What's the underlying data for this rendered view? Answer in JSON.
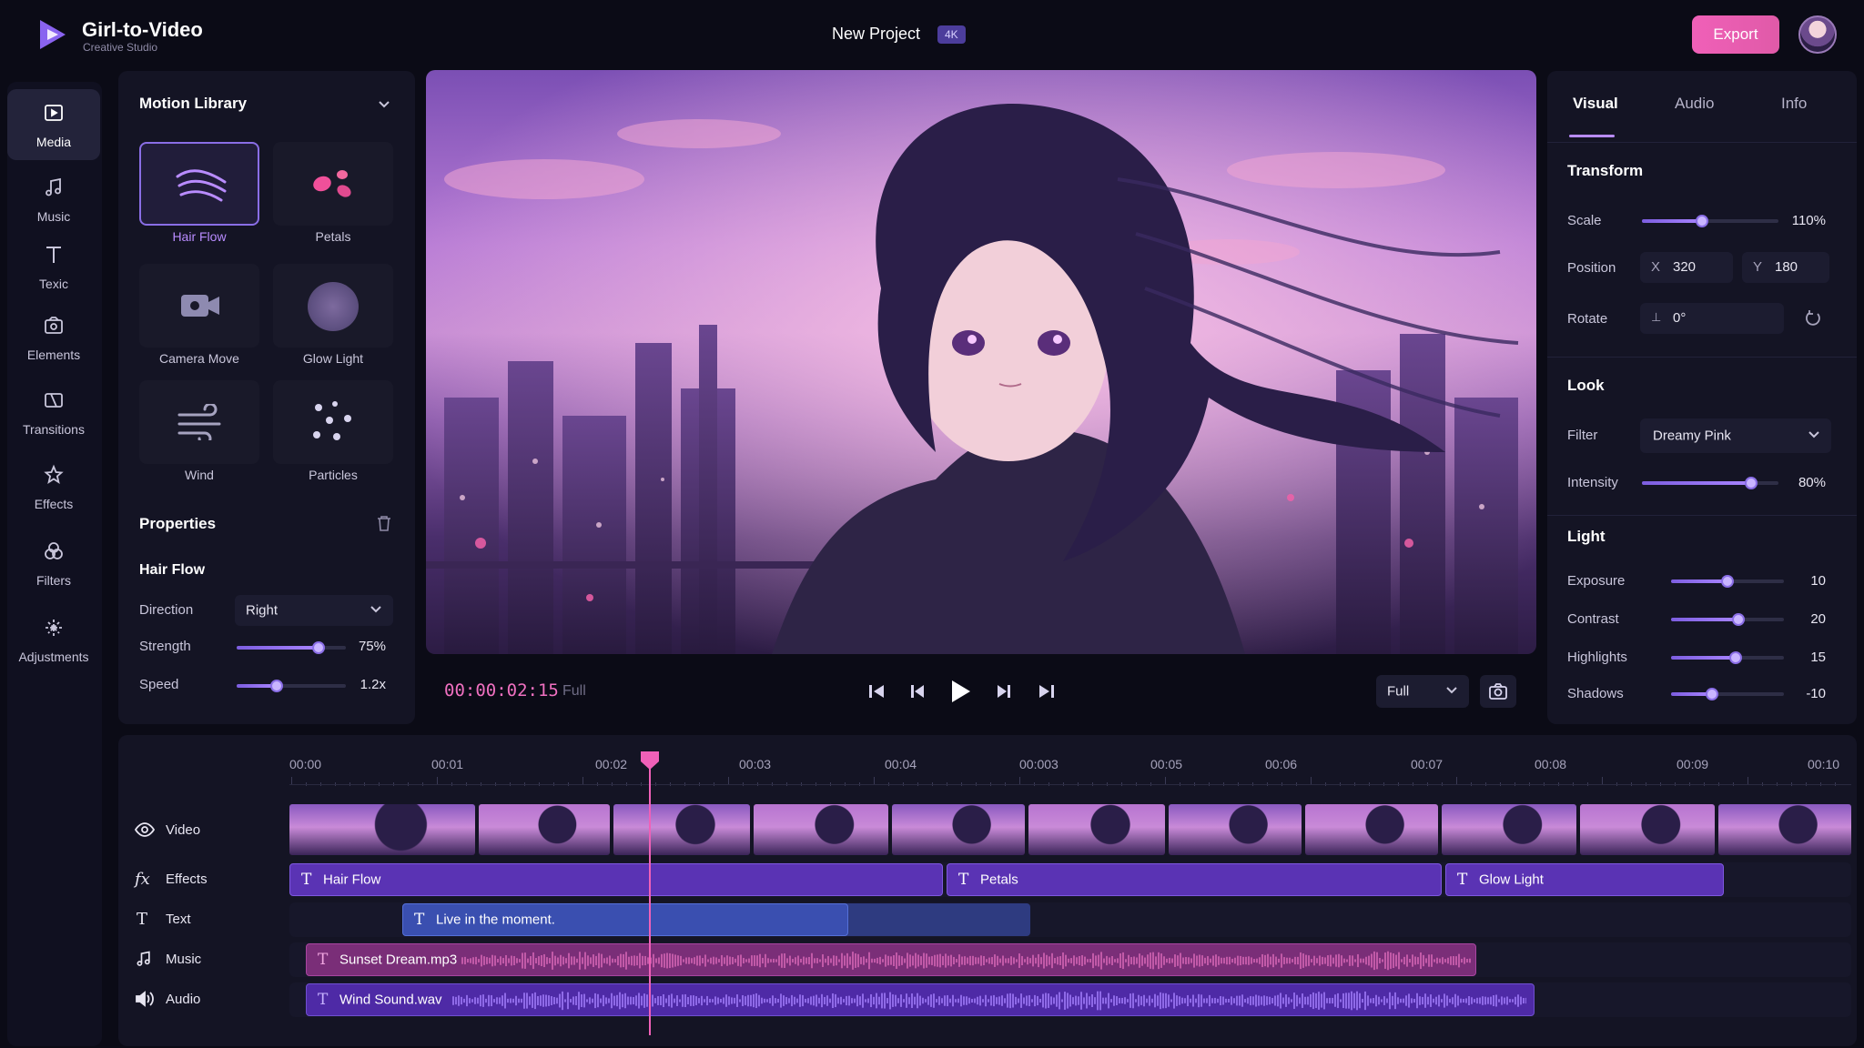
{
  "header": {
    "app_title": "Girl-to-Video",
    "app_subtitle": "Creative Studio",
    "project_name": "New Project",
    "resolution_badge": "4K",
    "export_label": "Export",
    "accent_color": "#f060b8"
  },
  "nav": {
    "items": [
      {
        "label": "Media",
        "icon": "media-icon",
        "active": true
      },
      {
        "label": "Music",
        "icon": "music-note-icon"
      },
      {
        "label": "Texic",
        "icon": "text-icon"
      },
      {
        "label": "Elements",
        "icon": "elements-icon"
      },
      {
        "label": "Transitions",
        "icon": "transitions-icon"
      },
      {
        "label": "Effects",
        "icon": "effects-icon"
      },
      {
        "label": "Filters",
        "icon": "filters-icon"
      },
      {
        "label": "Adjustments",
        "icon": "adjustments-icon"
      }
    ]
  },
  "library": {
    "title": "Motion Library",
    "tiles": [
      {
        "label": "Hair Flow",
        "icon": "hair-flow-icon",
        "active": true
      },
      {
        "label": "Petals",
        "icon": "petals-icon"
      },
      {
        "label": "Camera Move",
        "icon": "camera-icon"
      },
      {
        "label": "Glow Light",
        "icon": "glow-icon"
      },
      {
        "label": "Wind",
        "icon": "wind-icon"
      },
      {
        "label": "Particles",
        "icon": "particles-icon"
      }
    ]
  },
  "properties": {
    "title": "Properties",
    "effect_name": "Hair Flow",
    "direction_label": "Direction",
    "direction_value": "Right",
    "strength_label": "Strength",
    "strength_value": "75%",
    "strength_fraction": 0.75,
    "speed_label": "Speed",
    "speed_value": "1.2x",
    "speed_fraction": 0.37
  },
  "player": {
    "timecode": "00:00:02:15",
    "full_label": "Full",
    "quality_value": "Full"
  },
  "inspector": {
    "tabs": [
      "Visual",
      "Audio",
      "Info"
    ],
    "transform": {
      "title": "Transform",
      "scale_label": "Scale",
      "scale_value": "110%",
      "scale_fraction": 0.44,
      "position_label": "Position",
      "pos_x_label": "X",
      "pos_x": "320",
      "pos_y_label": "Y",
      "pos_y": "180",
      "rotate_label": "Rotate",
      "rotate_value": "0°"
    },
    "look": {
      "title": "Look",
      "filter_label": "Filter",
      "filter_value": "Dreamy Pink",
      "intensity_label": "Intensity",
      "intensity_value": "80%",
      "intensity_fraction": 0.8
    },
    "light": {
      "title": "Light",
      "rows": [
        {
          "label": "Exposure",
          "value": "10",
          "fraction": 0.5
        },
        {
          "label": "Contrast",
          "value": "20",
          "fraction": 0.6
        },
        {
          "label": "Highlights",
          "value": "15",
          "fraction": 0.57
        },
        {
          "label": "Shadows",
          "value": "-10",
          "fraction": 0.36
        }
      ]
    }
  },
  "timeline": {
    "ruler": [
      "00:00",
      "00:01",
      "00:02",
      "00:03",
      "00:04",
      "00:003",
      "00:05",
      "00:06",
      "00:07",
      "00:08",
      "00:09",
      "00:10"
    ],
    "tracks": [
      {
        "label": "Video",
        "icon": "eye-icon"
      },
      {
        "label": "Effects",
        "icon": "fx-icon"
      },
      {
        "label": "Text",
        "icon": "text-icon"
      },
      {
        "label": "Music",
        "icon": "music-note-icon"
      },
      {
        "label": "Audio",
        "icon": "speaker-icon"
      }
    ],
    "effect_clips": [
      "Hair Flow",
      "Petals",
      "Glow Light"
    ],
    "text_clip": "Live in the moment.",
    "music_clip": "Sunset Dream.mp3",
    "audio_clip": "Wind Sound.wav"
  }
}
